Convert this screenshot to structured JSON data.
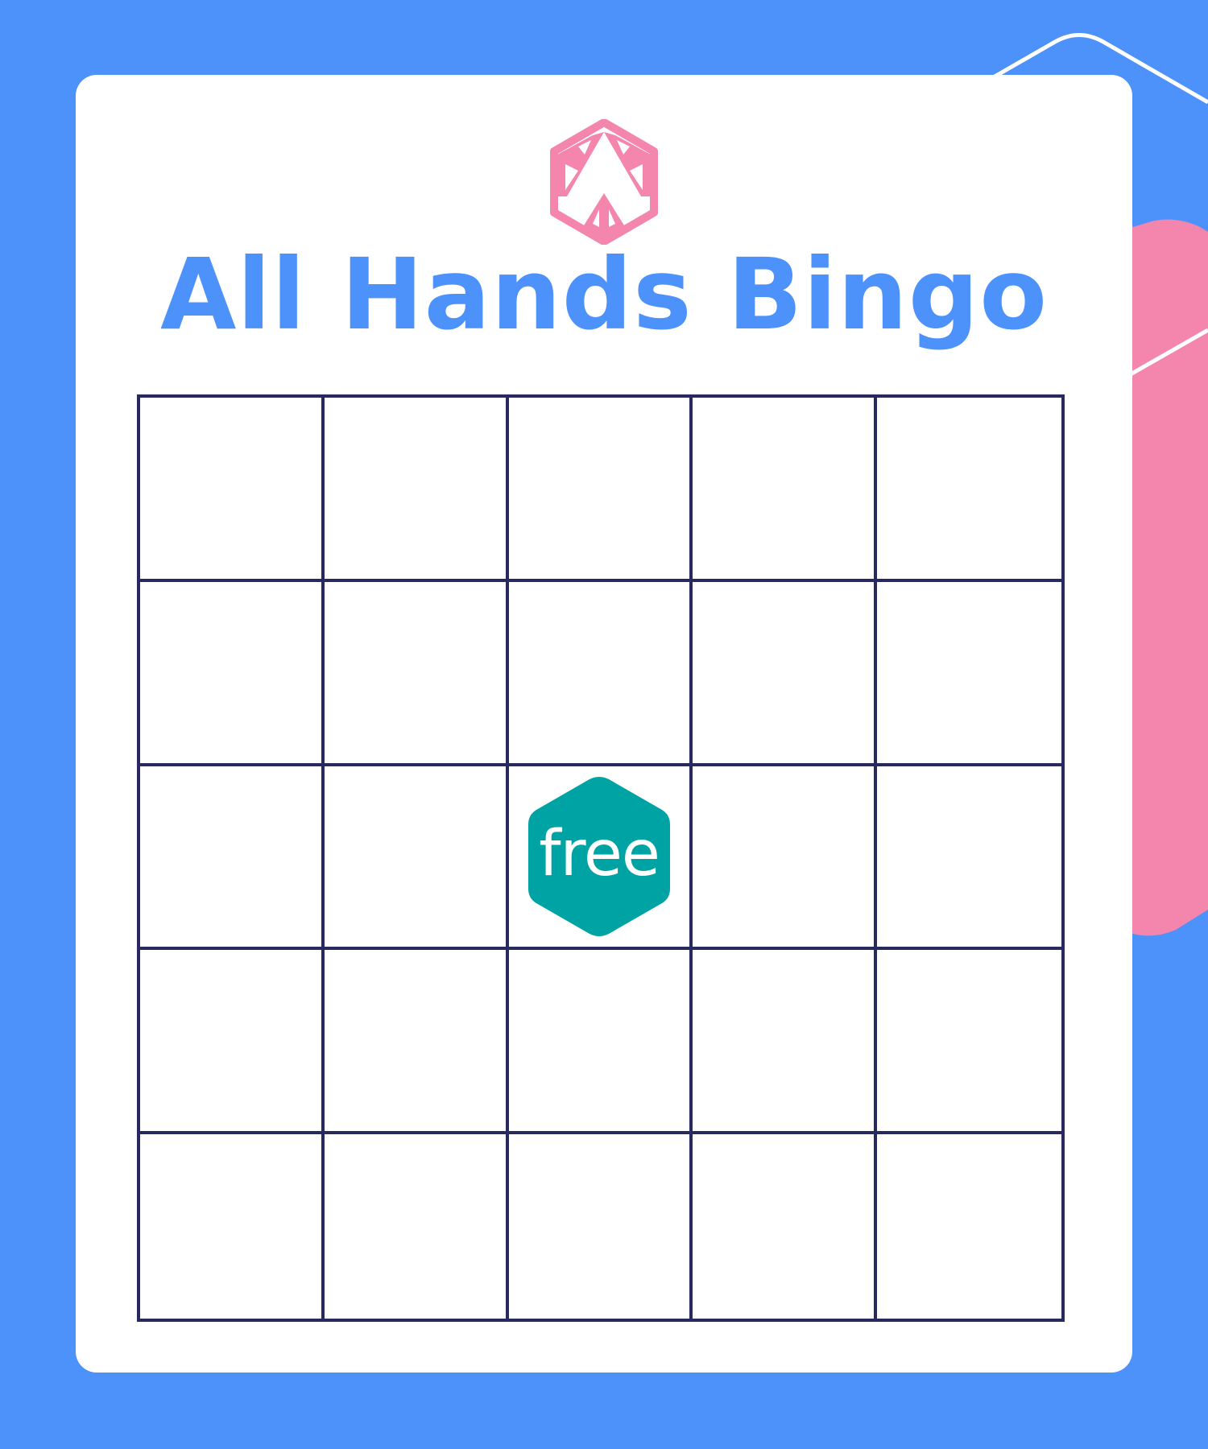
{
  "header": {
    "logo_icon": "pink-hexagon-logo-icon",
    "title": "All Hands Bingo"
  },
  "board": {
    "rows": 5,
    "cols": 5,
    "free_label": "free",
    "free_icon": "teal-hexagon-icon"
  },
  "colors": {
    "background": "#4d92fb",
    "card": "#ffffff",
    "title": "#4d92fb",
    "grid_lines": "#27295f",
    "free_badge": "#00a3a3",
    "logo": "#f486ad",
    "deco_pink": "#f486ad"
  }
}
